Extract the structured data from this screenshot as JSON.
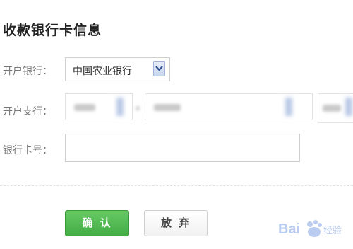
{
  "page": {
    "title": "收款银行卡信息"
  },
  "form": {
    "bank_label": "开户银行：",
    "bank_selected": "中国农业银行",
    "branch_label": "开户支行：",
    "card_label": "银行卡号：",
    "card_value": ""
  },
  "actions": {
    "confirm_label": "确认",
    "cancel_label": "放弃"
  },
  "watermark": {
    "text": "Bai du 经验"
  },
  "icons": {
    "dropdown": "chevron-down-icon"
  },
  "colors": {
    "confirm_bg": "#4cb64b",
    "border": "#cfcfcf",
    "label": "#777777"
  }
}
